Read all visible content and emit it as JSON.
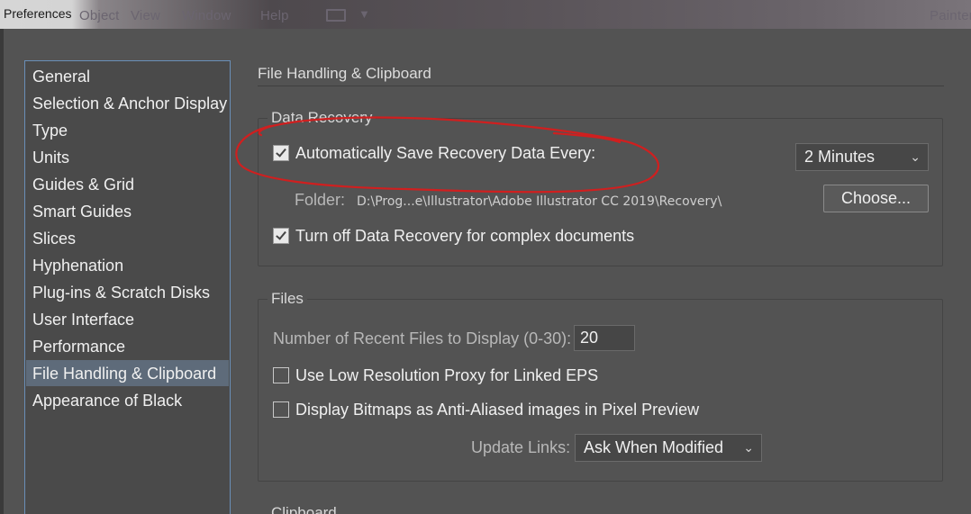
{
  "window": {
    "title": "Preferences"
  },
  "background_menu": {
    "items": [
      "Object",
      "View",
      "Window",
      "Help",
      "Painter"
    ]
  },
  "sidebar": {
    "items": [
      {
        "label": "General",
        "selected": false
      },
      {
        "label": "Selection & Anchor Display",
        "selected": false
      },
      {
        "label": "Type",
        "selected": false
      },
      {
        "label": "Units",
        "selected": false
      },
      {
        "label": "Guides & Grid",
        "selected": false
      },
      {
        "label": "Smart Guides",
        "selected": false
      },
      {
        "label": "Slices",
        "selected": false
      },
      {
        "label": "Hyphenation",
        "selected": false
      },
      {
        "label": "Plug-ins & Scratch Disks",
        "selected": false
      },
      {
        "label": "User Interface",
        "selected": false
      },
      {
        "label": "Performance",
        "selected": false
      },
      {
        "label": "File Handling & Clipboard",
        "selected": true
      },
      {
        "label": "Appearance of Black",
        "selected": false
      }
    ]
  },
  "main": {
    "section_title": "File Handling & Clipboard",
    "data_recovery": {
      "label": "Data Recovery",
      "auto_save": {
        "label": "Automatically Save Recovery Data Every:",
        "checked": true
      },
      "interval": {
        "value": "2 Minutes"
      },
      "folder": {
        "label": "Folder:",
        "path": "D:\\Prog...e\\Illustrator\\Adobe Illustrator CC 2019\\Recovery\\",
        "choose_label": "Choose..."
      },
      "complex_docs": {
        "label": "Turn off Data Recovery for complex documents",
        "checked": true
      }
    },
    "files": {
      "label": "Files",
      "recent_files": {
        "label": "Number of Recent Files to Display (0-30):",
        "value": "20"
      },
      "low_res_proxy": {
        "label": "Use Low Resolution Proxy for Linked EPS",
        "checked": false
      },
      "anti_aliased": {
        "label": "Display Bitmaps as Anti-Aliased images in Pixel Preview",
        "checked": false
      },
      "update_links": {
        "label": "Update Links:",
        "value": "Ask When Modified"
      }
    },
    "clipboard": {
      "label": "Clipboard"
    }
  },
  "annotation": {
    "color": "#d01f1f"
  }
}
